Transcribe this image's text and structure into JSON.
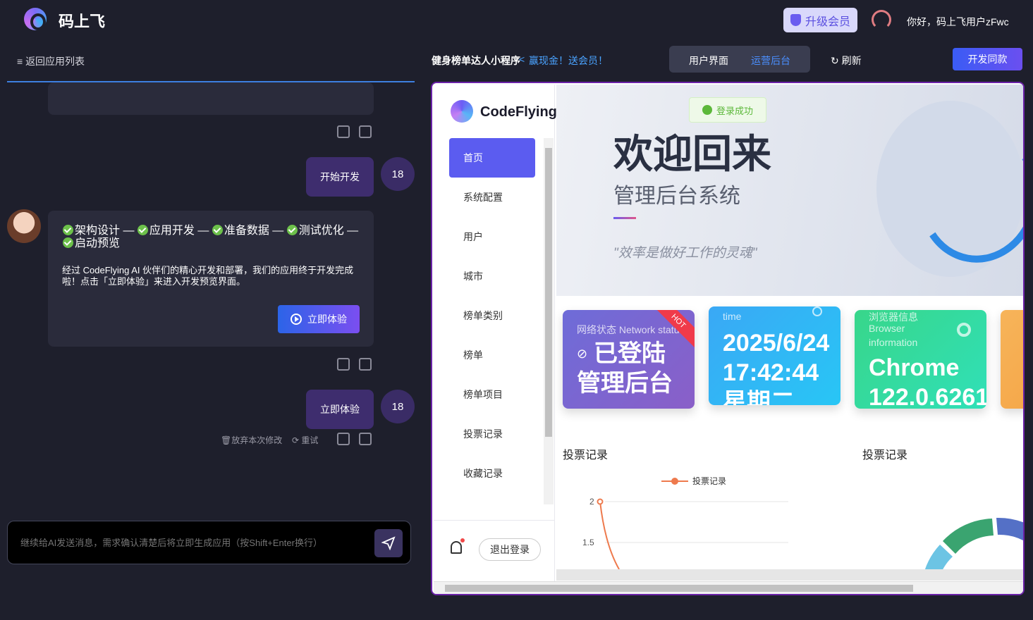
{
  "app": {
    "brand": "码上飞",
    "upgrade_label": "升级会员",
    "greeting": "你好，码上飞用户zFwc"
  },
  "subbar": {
    "back_label": "返回应用列表",
    "app_name": "健身榜单达人小程序",
    "promo": "赢现金！送会员！",
    "seg_user": "用户界面",
    "seg_admin": "运营后台",
    "refresh_label": "刷新",
    "dev_button": "开发同款"
  },
  "chat": {
    "user_msg_1": "开始开发",
    "user_avatar": "18",
    "steps": [
      "架构设计",
      "应用开发",
      "准备数据",
      "测试优化",
      "启动预览"
    ],
    "ai_message": "经过 CodeFlying AI 伙伴们的精心开发和部署，我们的应用终于开发完成啦！点击「立即体验」来进入开发预览界面。",
    "try_button": "立即体验",
    "user_msg_2": "立即体验",
    "discard_label": "放弃本次修改",
    "retry_label": "重试",
    "input_placeholder": "继续给AI发送消息，需求确认清楚后将立即生成应用（按Shift+Enter换行）"
  },
  "preview": {
    "brand": "CodeFlying",
    "menu": [
      "首页",
      "系统配置",
      "用户",
      "城市",
      "榜单类别",
      "榜单",
      "榜单项目",
      "投票记录",
      "收藏记录"
    ],
    "logout": "退出登录",
    "toast": "登录成功",
    "welcome": "欢迎回来",
    "subtitle": "管理后台系统",
    "quote": "\"效率是做好工作的灵魂\"",
    "card1": {
      "caption": "网络状态 Network status",
      "badge": "HOT",
      "line1": "已登陆",
      "line2": "管理后台"
    },
    "card2": {
      "caption": "time",
      "line1": "2025/6/24",
      "line2": "17:42:44",
      "line3": "星期二"
    },
    "card3": {
      "caption_cn": "浏览器信息",
      "caption_en1": "Browser",
      "caption_en2": "information",
      "line1": "Chrome",
      "line2": "122.0.6261"
    },
    "section_left": "投票记录",
    "section_right": "投票记录",
    "legend": "投票记录",
    "y_ticks": [
      "2",
      "1.5"
    ]
  },
  "colors": {
    "accent": "#5b5cf0",
    "frame": "#6b22a8",
    "success": "#5cb83a"
  }
}
